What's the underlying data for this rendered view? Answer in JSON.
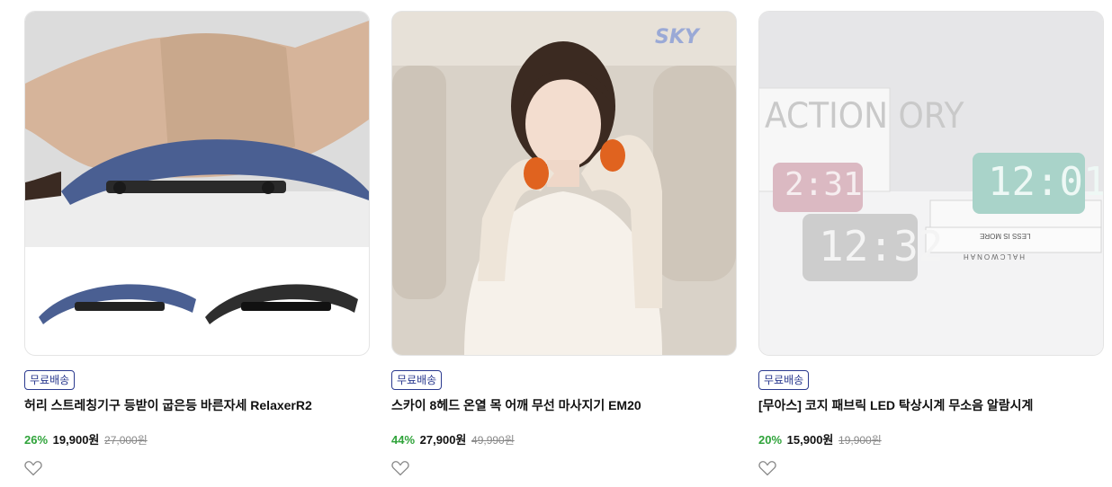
{
  "products": [
    {
      "badge": "무료배송",
      "title": "허리 스트레칭기구 등받이 굽은등 바른자세 RelaxerR2",
      "discount": "26%",
      "price": "19,900원",
      "original_price": "27,000원"
    },
    {
      "badge": "무료배송",
      "title": "스카이 8헤드 온열 목 어깨 무선 마사지기 EM20",
      "discount": "44%",
      "price": "27,900원",
      "original_price": "49,990원",
      "image_text": "SKY"
    },
    {
      "badge": "무료배송",
      "title": "[무아스] 코지 패브릭 LED 탁상시계 무소음 알람시계",
      "discount": "20%",
      "price": "15,900원",
      "original_price": "19,900원",
      "image_text": {
        "clock_pink": "2:31",
        "clock_mint": "12:01",
        "clock_gray": "12:32",
        "poster": "ACTION ORY",
        "book1": "LESS IS MORE",
        "book2": "HALCWONAH"
      }
    }
  ],
  "colors": {
    "badge": "#2b3a8f",
    "discount": "#2fa33a"
  }
}
